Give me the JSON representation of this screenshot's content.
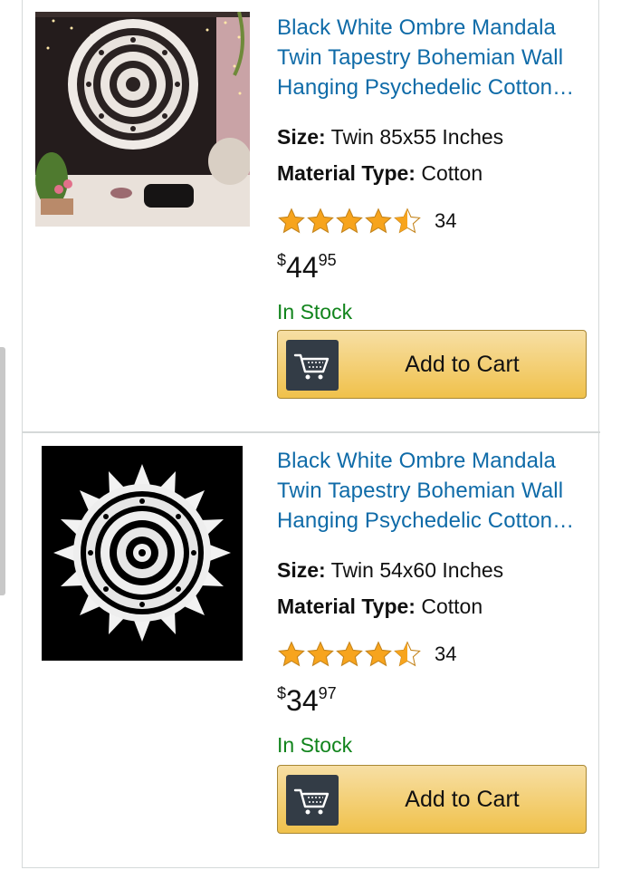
{
  "products": [
    {
      "title": "Black White Ombre Mandala Twin Tapestry Bohemian Wall Hanging Psychedelic Cotton…",
      "size_label": "Size:",
      "size_value": "Twin 85x55 Inches",
      "material_label": "Material Type:",
      "material_value": "Cotton",
      "rating_stars": 4.5,
      "rating_count": "34",
      "price_currency": "$",
      "price_whole": "44",
      "price_fraction": "95",
      "availability": "In Stock",
      "cart_label": "Add to Cart"
    },
    {
      "title": "Black White Ombre Mandala Twin Tapestry Bohemian Wall Hanging Psychedelic Cotton…",
      "size_label": "Size:",
      "size_value": "Twin 54x60 Inches",
      "material_label": "Material Type:",
      "material_value": "Cotton",
      "rating_stars": 4.5,
      "rating_count": "34",
      "price_currency": "$",
      "price_whole": "34",
      "price_fraction": "97",
      "availability": "In Stock",
      "cart_label": "Add to Cart"
    }
  ],
  "colors": {
    "link": "#0f6ba8",
    "in_stock": "#11841c",
    "star": "#f7a41d",
    "button_top": "#f7dfa4",
    "button_bottom": "#f0c14b",
    "cart_icon_bg": "#333c46"
  },
  "icons": {
    "cart": "shopping-cart-icon",
    "star_full": "star-full-icon",
    "star_half": "star-half-icon"
  }
}
